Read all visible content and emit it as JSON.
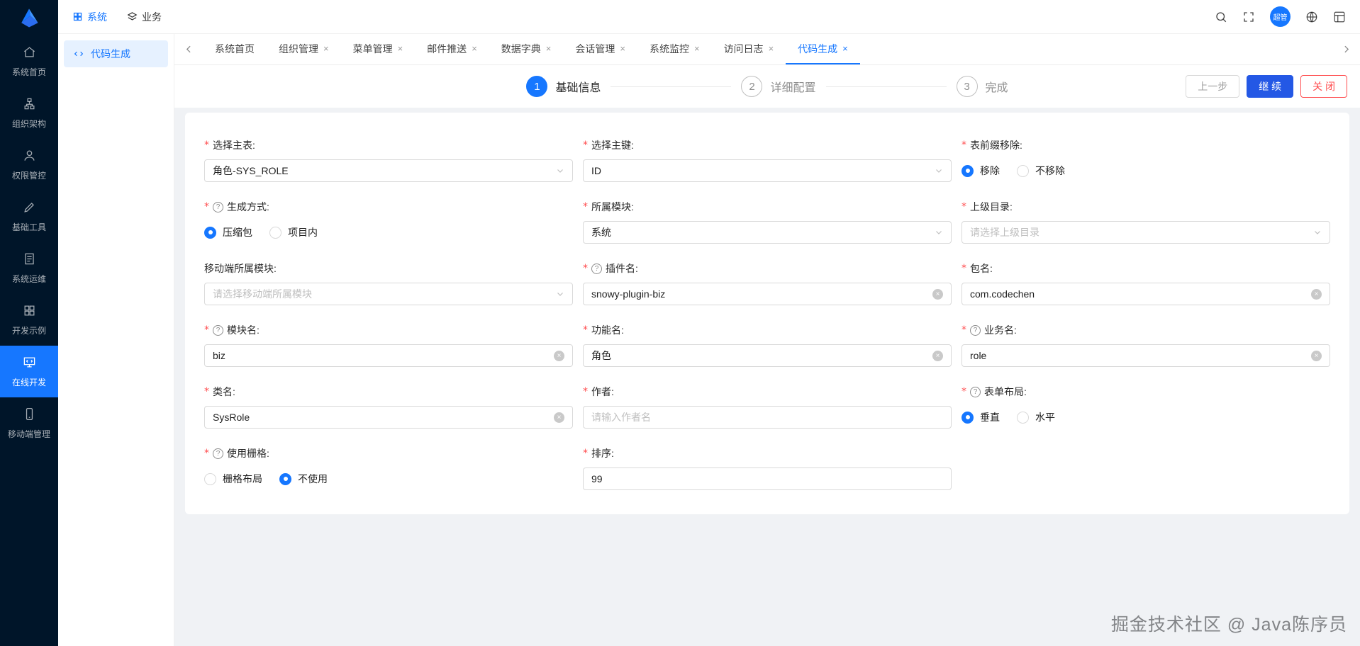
{
  "topbar": {
    "nav": [
      {
        "label": "系统"
      },
      {
        "label": "业务"
      }
    ],
    "avatar_text": "超管"
  },
  "sidebar": {
    "items": [
      {
        "label": "系统首页"
      },
      {
        "label": "组织架构"
      },
      {
        "label": "权限管控"
      },
      {
        "label": "基础工具"
      },
      {
        "label": "系统运维"
      },
      {
        "label": "开发示例"
      },
      {
        "label": "在线开发"
      },
      {
        "label": "移动端管理"
      }
    ]
  },
  "submenu": {
    "active_item": "代码生成"
  },
  "tabs": {
    "close_mark": "×",
    "items": [
      {
        "label": "系统首页"
      },
      {
        "label": "组织管理"
      },
      {
        "label": "菜单管理"
      },
      {
        "label": "邮件推送"
      },
      {
        "label": "数据字典"
      },
      {
        "label": "会话管理"
      },
      {
        "label": "系统监控"
      },
      {
        "label": "访问日志"
      },
      {
        "label": "代码生成"
      }
    ]
  },
  "steps": {
    "items": [
      {
        "num": "1",
        "label": "基础信息"
      },
      {
        "num": "2",
        "label": "详细配置"
      },
      {
        "num": "3",
        "label": "完成"
      }
    ]
  },
  "actions": {
    "prev_label": "上一步",
    "continue_label": "继 续",
    "close_label": "关 闭"
  },
  "form": {
    "required_mark": "*",
    "help_mark": "?",
    "clear_mark": "×",
    "fields": [
      {
        "label": "选择主表:",
        "type": "select",
        "value": "角色-SYS_ROLE"
      },
      {
        "label": "选择主键:",
        "type": "select",
        "value": "ID"
      },
      {
        "label": "表前缀移除:",
        "type": "radio",
        "options": [
          "移除",
          "不移除"
        ],
        "selected": 0
      },
      {
        "label": "生成方式:",
        "type": "radio",
        "options": [
          "压缩包",
          "项目内"
        ],
        "selected": 0
      },
      {
        "label": "所属模块:",
        "type": "select",
        "value": "系统"
      },
      {
        "label": "上级目录:",
        "type": "select",
        "placeholder": "请选择上级目录"
      },
      {
        "label": "移动端所属模块:",
        "type": "select",
        "placeholder": "请选择移动端所属模块"
      },
      {
        "label": "插件名:",
        "type": "input",
        "value": "snowy-plugin-biz"
      },
      {
        "label": "包名:",
        "type": "input",
        "value": "com.codechen"
      },
      {
        "label": "模块名:",
        "type": "input",
        "value": "biz"
      },
      {
        "label": "功能名:",
        "type": "input",
        "value": "角色"
      },
      {
        "label": "业务名:",
        "type": "input",
        "value": "role"
      },
      {
        "label": "类名:",
        "type": "input",
        "value": "SysRole"
      },
      {
        "label": "作者:",
        "type": "input",
        "placeholder": "请输入作者名"
      },
      {
        "label": "表单布局:",
        "type": "radio",
        "options": [
          "垂直",
          "水平"
        ],
        "selected": 0
      },
      {
        "label": "使用栅格:",
        "type": "radio",
        "options": [
          "栅格布局",
          "不使用"
        ],
        "selected": 1
      },
      {
        "label": "排序:",
        "type": "input",
        "value": "99"
      }
    ]
  },
  "watermark": "掘金技术社区 @ Java陈序员"
}
